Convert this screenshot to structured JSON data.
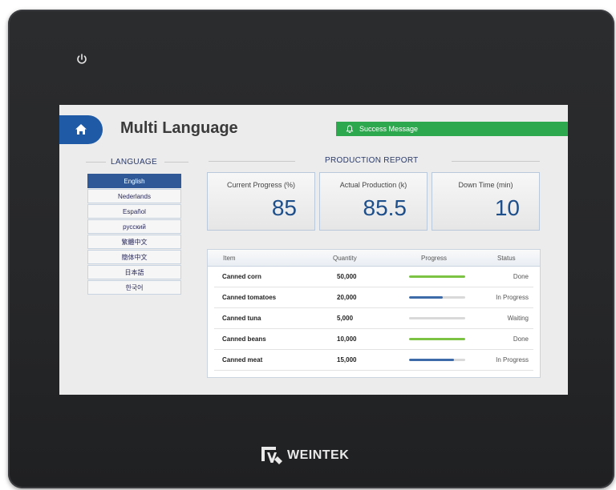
{
  "device": {
    "brand": "WEINTEK"
  },
  "header": {
    "title": "Multi Language",
    "message": "Success Message"
  },
  "language": {
    "heading": "LANGUAGE",
    "items": [
      "English",
      "Nederlands",
      "Español",
      "русский",
      "繁體中文",
      "簡体中文",
      "日本語",
      "한국어"
    ],
    "selected": "English"
  },
  "report": {
    "heading": "PRODUCTION REPORT",
    "cards": [
      {
        "label": "Current Progress (%)",
        "value": "85"
      },
      {
        "label": "Actual Production (k)",
        "value": "85.5"
      },
      {
        "label": "Down Time (min)",
        "value": "10"
      }
    ]
  },
  "table": {
    "headers": [
      "Item",
      "Quantity",
      "Progress",
      "Status"
    ],
    "rows": [
      {
        "item": "Canned corn",
        "quantity": "50,000",
        "progress": 1.0,
        "status": "Done"
      },
      {
        "item": "Canned tomatoes",
        "quantity": "20,000",
        "progress": 0.6,
        "status": "In Progress"
      },
      {
        "item": "Canned tuna",
        "quantity": "5,000",
        "progress": 0.0,
        "status": "Waiting"
      },
      {
        "item": "Canned beans",
        "quantity": "10,000",
        "progress": 1.0,
        "status": "Done"
      },
      {
        "item": "Canned meat",
        "quantity": "15,000",
        "progress": 0.8,
        "status": "In Progress"
      }
    ]
  },
  "colors": {
    "accent": "#1f5aa6",
    "success": "#2ea84f",
    "done_bar": "#7cc243",
    "progress_bar": "#3d6aa8"
  }
}
